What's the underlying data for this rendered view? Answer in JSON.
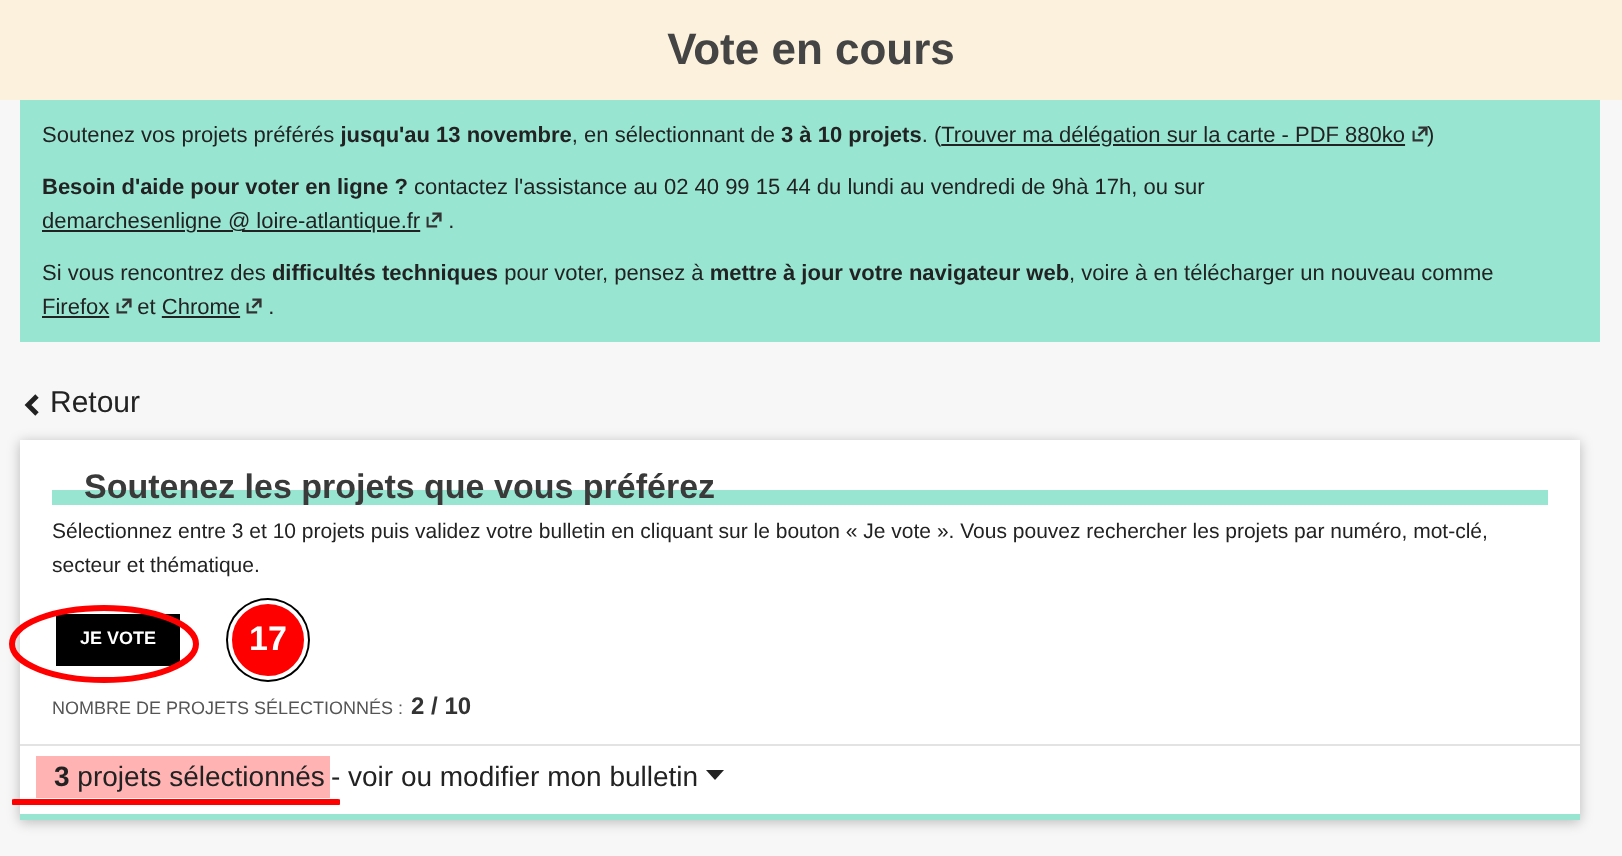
{
  "header": {
    "title": "Vote en cours"
  },
  "notice": {
    "paragraphs": [
      [
        {
          "kind": "text",
          "text": "Soutenez vos projets préférés **jusqu'au 13 novembre**, en sélectionnant de **3 à 10 projets**. ("
        },
        {
          "kind": "link",
          "text": "Trouver ma délégation sur la carte - PDF 880ko"
        },
        {
          "kind": "text",
          "text": ")"
        }
      ],
      [
        {
          "kind": "text",
          "text": "**Besoin d'aide pour voter en ligne ?** contactez l'assistance au 02 40 99 15 44 du lundi au vendredi de 9hà 17h, ou sur "
        },
        {
          "kind": "link",
          "text": "demarchesenligne @ loire-atlantique.fr"
        },
        {
          "kind": "text",
          "text": " ."
        }
      ],
      [
        {
          "kind": "text",
          "text": "Si vous rencontrez des **difficultés techniques** pour voter, pensez à **mettre à jour votre navigateur web**, voire à en télécharger un nouveau comme "
        },
        {
          "kind": "link",
          "text": "Firefox"
        },
        {
          "kind": "text",
          "text": " et "
        },
        {
          "kind": "link",
          "text": "Chrome"
        },
        {
          "kind": "text",
          "text": " ."
        }
      ]
    ]
  },
  "back_link": {
    "label": "Retour"
  },
  "card": {
    "title": "Soutenez les projets que vous préférez",
    "description": "Sélectionnez entre 3 et 10 projets puis validez votre bulletin en cliquant sur le bouton « Je vote ». Vous pouvez rechercher les projets par numéro, mot-clé, secteur et thématique.",
    "vote_button": "JE VOTE",
    "step_badge": "17",
    "counter_label": "NOMBRE DE PROJETS SÉLECTIONNÉS :",
    "counter_value": "2 / 10",
    "footer": {
      "selected": "**3** projets sélectionnés",
      "action": " - voir ou modifier mon bulletin"
    }
  }
}
